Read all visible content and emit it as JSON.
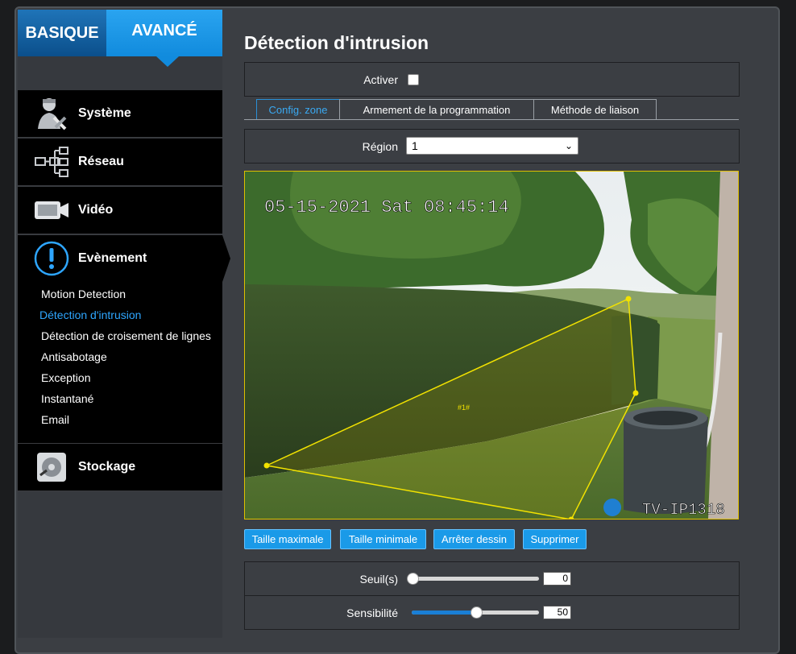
{
  "mode_tabs": {
    "basic": "BASIQUE",
    "advanced": "AVANCÉ"
  },
  "menu": {
    "systeme": {
      "label": "Système",
      "icon": "tools-user-icon"
    },
    "reseau": {
      "label": "Réseau",
      "icon": "network-icon"
    },
    "video": {
      "label": "Vidéo",
      "icon": "camera-icon"
    },
    "evenement": {
      "label": "Evènement",
      "icon": "alert-icon"
    },
    "stockage": {
      "label": "Stockage",
      "icon": "disk-icon"
    }
  },
  "event_submenu": [
    "Motion Detection",
    "Détection d'intrusion",
    "Détection de croisement de lignes",
    "Antisabotage",
    "Exception",
    "Instantané",
    "Email"
  ],
  "page": {
    "title": "Détection d'intrusion"
  },
  "enable": {
    "label": "Activer",
    "checked": false
  },
  "tabs": [
    "Config. zone",
    "Armement de la programmation",
    "Méthode de liaison"
  ],
  "region": {
    "label": "Région",
    "value": "1"
  },
  "video": {
    "timestamp": "05-15-2021 Sat 08:45:14",
    "camera_name": "TV-IP1318",
    "zone_label": "#1#",
    "zone_color": "#f2e200"
  },
  "buttons": [
    "Taille maximale",
    "Taille minimale",
    "Arrêter dessin",
    "Supprimer"
  ],
  "threshold": {
    "label": "Seuil(s)",
    "value": "0",
    "fraction": 0
  },
  "sensitivity": {
    "label": "Sensibilité",
    "value": "50",
    "fraction": 0.5
  },
  "colors": {
    "accent": "#1a9ae8",
    "active_link": "#2ea6ff",
    "sidebar_bg": "#000000"
  }
}
